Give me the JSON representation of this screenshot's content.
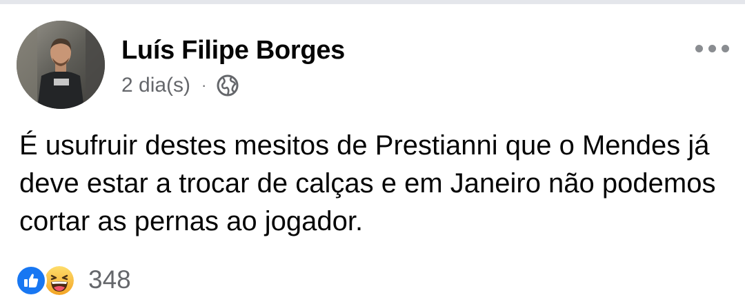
{
  "post": {
    "author": {
      "name": "Luís Filipe Borges"
    },
    "meta": {
      "time": "2 dia(s)",
      "separator": "·",
      "privacy_icon": "globe-icon"
    },
    "more_icon": "more-horizontal-icon",
    "text": "É usufruir destes mesitos de Prestianni que o Mendes já deve estar a trocar de calças e em Janeiro não podemos cortar as pernas ao jogador.",
    "reactions": {
      "icons": [
        "like-icon",
        "haha-icon"
      ],
      "count": "348"
    }
  },
  "colors": {
    "text_primary": "#050505",
    "text_secondary": "#65676b",
    "like_blue": "#1877f2",
    "haha_yellow": "#f7b125",
    "divider": "#e4e6eb"
  }
}
